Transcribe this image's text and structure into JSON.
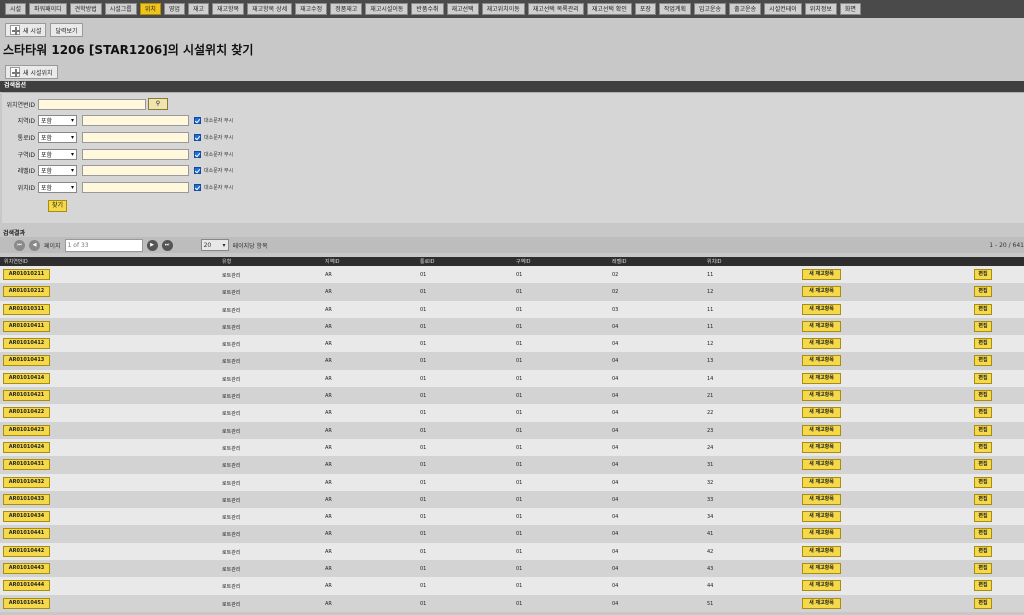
{
  "nav": {
    "tabs": [
      {
        "label": "시설",
        "active": false
      },
      {
        "label": "파워패이디",
        "active": false
      },
      {
        "label": "견학방법",
        "active": false
      },
      {
        "label": "시설그룹",
        "active": false
      },
      {
        "label": "위치",
        "active": true
      },
      {
        "label": "영업",
        "active": false
      },
      {
        "label": "재고",
        "active": false
      },
      {
        "label": "재고항목",
        "active": false
      },
      {
        "label": "재고항목 상세",
        "active": false
      },
      {
        "label": "재고수정",
        "active": false
      },
      {
        "label": "정품재고",
        "active": false
      },
      {
        "label": "재고시설이동",
        "active": false
      },
      {
        "label": "반품수취",
        "active": false
      },
      {
        "label": "재고선택",
        "active": false
      },
      {
        "label": "재고위치이동",
        "active": false
      },
      {
        "label": "재고선택 목록관리",
        "active": false
      },
      {
        "label": "재고선택 확인",
        "active": false
      },
      {
        "label": "포장",
        "active": false
      },
      {
        "label": "작업계획",
        "active": false
      },
      {
        "label": "입고운송",
        "active": false
      },
      {
        "label": "출고운송",
        "active": false
      },
      {
        "label": "시설컨테이",
        "active": false
      },
      {
        "label": "위치정보",
        "active": false
      },
      {
        "label": "화면",
        "active": false
      }
    ]
  },
  "actions": {
    "new_facility": "새 시설",
    "calendar": "달력보기",
    "new_location": "새 시설위치"
  },
  "page": {
    "title_prefix": "스타타워",
    "facility": "1206 [STAR1206]",
    "title_suffix": "의 시설위치 찾기"
  },
  "search": {
    "section_title": "검색옵션",
    "location_seq_label": "위치연번ID",
    "location_seq_value": "",
    "lookup_icon": "lookup-icon",
    "fields": [
      {
        "label": "지역ID",
        "op": "포함",
        "value": "",
        "ignore_case": "대소문자 무시"
      },
      {
        "label": "통로ID",
        "op": "포함",
        "value": "",
        "ignore_case": "대소문자 무시"
      },
      {
        "label": "구역ID",
        "op": "포함",
        "value": "",
        "ignore_case": "대소문자 무시"
      },
      {
        "label": "레벨ID",
        "op": "포함",
        "value": "",
        "ignore_case": "대소문자 무시"
      },
      {
        "label": "위치ID",
        "op": "포함",
        "value": "",
        "ignore_case": "대소문자 무시"
      }
    ],
    "find_label": "찾기"
  },
  "results": {
    "section_title": "검색결과",
    "page_label": "페이지",
    "page_placeholder": "1 of 33",
    "per_page_value": "20",
    "per_page_label": "페이지당 항목",
    "range": "1 - 20 / 641"
  },
  "grid": {
    "headers": [
      "위치연번ID",
      "유형",
      "지역ID",
      "통로ID",
      "구역ID",
      "레벨ID",
      "위치ID"
    ],
    "add_label": "새 재고항목",
    "edit_label": "편집",
    "rows": [
      {
        "code": "AR01010211",
        "type": "로트관리",
        "area": "AR",
        "aisle": "01",
        "section": "01",
        "level": "02",
        "pos": "11"
      },
      {
        "code": "AR01010212",
        "type": "로트관리",
        "area": "AR",
        "aisle": "01",
        "section": "01",
        "level": "02",
        "pos": "12"
      },
      {
        "code": "AR01010311",
        "type": "로트관리",
        "area": "AR",
        "aisle": "01",
        "section": "01",
        "level": "03",
        "pos": "11"
      },
      {
        "code": "AR01010411",
        "type": "로트관리",
        "area": "AR",
        "aisle": "01",
        "section": "01",
        "level": "04",
        "pos": "11"
      },
      {
        "code": "AR01010412",
        "type": "로트관리",
        "area": "AR",
        "aisle": "01",
        "section": "01",
        "level": "04",
        "pos": "12"
      },
      {
        "code": "AR01010413",
        "type": "로트관리",
        "area": "AR",
        "aisle": "01",
        "section": "01",
        "level": "04",
        "pos": "13"
      },
      {
        "code": "AR01010414",
        "type": "로트관리",
        "area": "AR",
        "aisle": "01",
        "section": "01",
        "level": "04",
        "pos": "14"
      },
      {
        "code": "AR01010421",
        "type": "로트관리",
        "area": "AR",
        "aisle": "01",
        "section": "01",
        "level": "04",
        "pos": "21"
      },
      {
        "code": "AR01010422",
        "type": "로트관리",
        "area": "AR",
        "aisle": "01",
        "section": "01",
        "level": "04",
        "pos": "22"
      },
      {
        "code": "AR01010423",
        "type": "로트관리",
        "area": "AR",
        "aisle": "01",
        "section": "01",
        "level": "04",
        "pos": "23"
      },
      {
        "code": "AR01010424",
        "type": "로트관리",
        "area": "AR",
        "aisle": "01",
        "section": "01",
        "level": "04",
        "pos": "24"
      },
      {
        "code": "AR01010431",
        "type": "로트관리",
        "area": "AR",
        "aisle": "01",
        "section": "01",
        "level": "04",
        "pos": "31"
      },
      {
        "code": "AR01010432",
        "type": "로트관리",
        "area": "AR",
        "aisle": "01",
        "section": "01",
        "level": "04",
        "pos": "32"
      },
      {
        "code": "AR01010433",
        "type": "로트관리",
        "area": "AR",
        "aisle": "01",
        "section": "01",
        "level": "04",
        "pos": "33"
      },
      {
        "code": "AR01010434",
        "type": "로트관리",
        "area": "AR",
        "aisle": "01",
        "section": "01",
        "level": "04",
        "pos": "34"
      },
      {
        "code": "AR01010441",
        "type": "로트관리",
        "area": "AR",
        "aisle": "01",
        "section": "01",
        "level": "04",
        "pos": "41"
      },
      {
        "code": "AR01010442",
        "type": "로트관리",
        "area": "AR",
        "aisle": "01",
        "section": "01",
        "level": "04",
        "pos": "42"
      },
      {
        "code": "AR01010443",
        "type": "로트관리",
        "area": "AR",
        "aisle": "01",
        "section": "01",
        "level": "04",
        "pos": "43"
      },
      {
        "code": "AR01010444",
        "type": "로트관리",
        "area": "AR",
        "aisle": "01",
        "section": "01",
        "level": "04",
        "pos": "44"
      },
      {
        "code": "AR01010451",
        "type": "로트관리",
        "area": "AR",
        "aisle": "01",
        "section": "01",
        "level": "04",
        "pos": "51"
      }
    ]
  },
  "colors": {
    "accent": "#f0c419",
    "button_yellow": "#f5d94a",
    "header_dark": "#3f3f3f"
  }
}
